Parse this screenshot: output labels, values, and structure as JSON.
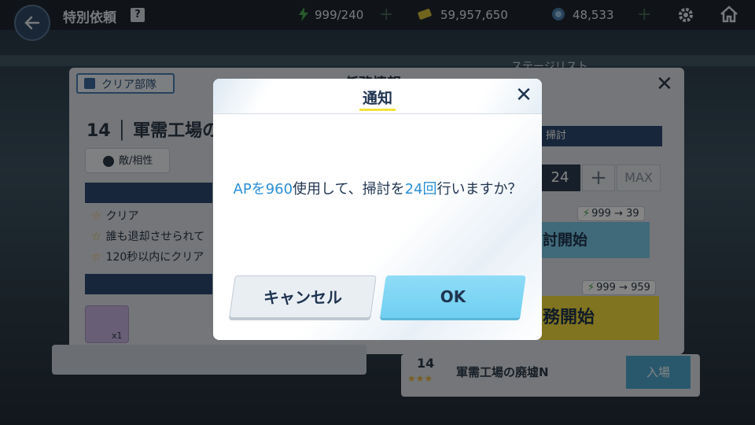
{
  "topbar": {
    "title": "特別依頼",
    "help": "?",
    "ap": "999/240",
    "credits": "59,957,650",
    "gems": "48,533"
  },
  "background": {
    "clear_party": "クリア部隊",
    "panel_title": "任務情報",
    "stage_list_title": "ステージリスト",
    "stage_head": "14 │ 軍需工場の廃",
    "enemy_btn": "敵/相性",
    "conditions": [
      "クリア",
      "誰も退却させられて",
      "120秒以内にクリア"
    ],
    "item_count": "x1",
    "sweep_header": "掃討",
    "sweep_count": "24",
    "plus": "+",
    "max": "MAX",
    "ap_sweep": "999 → 39",
    "sweep_start": "討開始",
    "ap_mission": "999 → 959",
    "mission_start": "務開始",
    "list_num": "14",
    "list_stars": "★★★",
    "list_name": "軍需工場の廃墟N",
    "enter": "入場"
  },
  "dialog": {
    "title": "通知",
    "msg_part1": "APを",
    "msg_ap": "960",
    "msg_part2": "使用して、掃討を",
    "msg_count": "24回",
    "msg_part3": "行いますか？",
    "cancel": "キャンセル",
    "ok": "OK"
  },
  "colors": {
    "accent": "#2a8fd6",
    "ok_button": "#6fcff2",
    "title_underline": "#f2e23a"
  }
}
